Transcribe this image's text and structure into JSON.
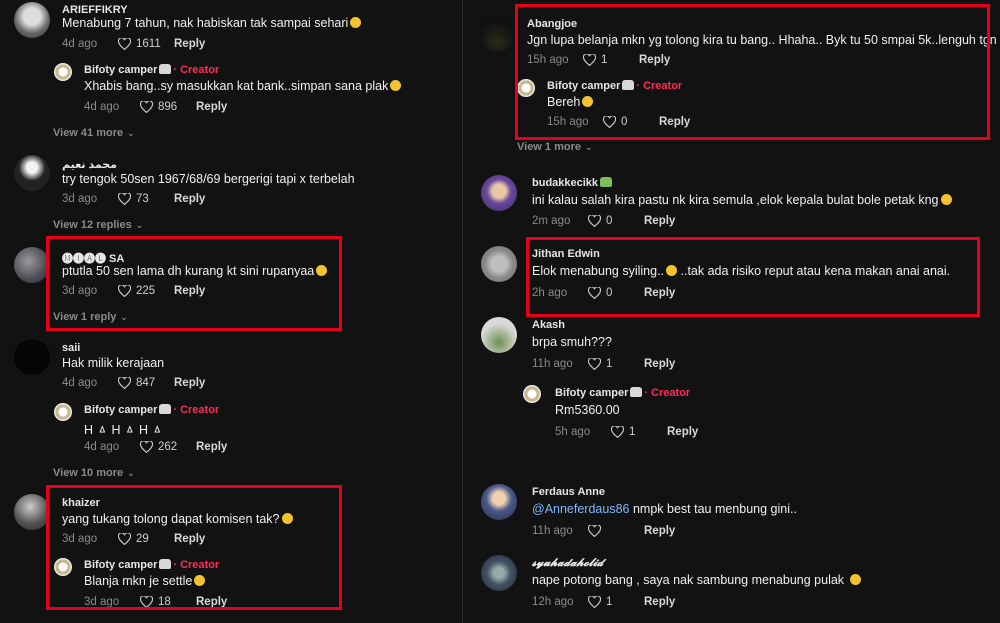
{
  "left": {
    "comments": [
      {
        "user": "ARIEFFIKRY",
        "text": "Menabung 7 tahun, nak habiskan tak sampai sehari",
        "time": "4d ago",
        "likes": "1611",
        "reply": "Reply"
      },
      {
        "user": "Bifoty camper",
        "creator": "· Creator",
        "text": "Xhabis bang..sy masukkan kat bank..simpan sana plak",
        "time": "4d ago",
        "likes": "896",
        "reply": "Reply"
      },
      {
        "view_more": "View 41 more"
      },
      {
        "user": "محمد نعيم",
        "text": "try tengok 50sen 1967/68/69 bergerigi tapi x terbelah",
        "time": "3d ago",
        "likes": "73",
        "reply": "Reply"
      },
      {
        "view_more": "View 12 replies"
      },
      {
        "user": "🅜🅘🅐🅛 SA",
        "text": "ptutla 50 sen lama dh kurang kt sini rupanyaa",
        "time": "3d ago",
        "likes": "225",
        "reply": "Reply"
      },
      {
        "view_more": "View 1 reply"
      },
      {
        "user": "saii",
        "text": "Hak milik kerajaan",
        "time": "4d ago",
        "likes": "847",
        "reply": "Reply"
      },
      {
        "user": "Bifoty camper",
        "creator": "· Creator",
        "text": "H ㅿ H ㅿ H ㅿ",
        "time": "4d ago",
        "likes": "262",
        "reply": "Reply"
      },
      {
        "view_more": "View 10 more"
      },
      {
        "user": "khaizer",
        "text": "yang tukang tolong dapat komisen tak?",
        "time": "3d ago",
        "likes": "29",
        "reply": "Reply"
      },
      {
        "user": "Bifoty camper",
        "creator": "· Creator",
        "text": "Blanja mkn je settle",
        "time": "3d ago",
        "likes": "18",
        "reply": "Reply"
      }
    ]
  },
  "right": {
    "comments": [
      {
        "user": "Abangjoe",
        "text": "Jgn lupa belanja mkn yg tolong kira tu bang.. Hhaha.. Byk tu 50 smpai 5k..lenguh tgn",
        "time": "15h ago",
        "likes": "1",
        "reply": "Reply"
      },
      {
        "user": "Bifoty camper",
        "creator": "· Creator",
        "text": "Bereh",
        "time": "15h ago",
        "likes": "0",
        "reply": "Reply"
      },
      {
        "view_more": "View 1 more"
      },
      {
        "user": "budakkecikk",
        "text": "ini kalau salah kira pastu nk kira semula ,elok kepala bulat bole petak kng",
        "time": "2m ago",
        "likes": "0",
        "reply": "Reply"
      },
      {
        "user": "Jithan Edwin",
        "text": "Elok menabung syiling..",
        "text2": "..tak ada risiko reput atau kena makan anai anai.",
        "time": "2h ago",
        "likes": "0",
        "reply": "Reply"
      },
      {
        "user": "Akash",
        "text": "brpa smuh???",
        "time": "11h ago",
        "likes": "1",
        "reply": "Reply"
      },
      {
        "user": "Bifoty camper",
        "creator": "· Creator",
        "text": "Rm5360.00",
        "time": "5h ago",
        "likes": "1",
        "reply": "Reply"
      },
      {
        "user": "Ferdaus Anne",
        "mention": "@Anneferdaus86",
        "text": " nmpk best tau menbung gini..",
        "time": "11h ago",
        "likes": "",
        "reply": "Reply"
      },
      {
        "user": "𝓼𝔂𝓾𝓱𝓪𝓭𝓪𝓱𝓸𝓵𝓲𝓭",
        "text": "nape potong bang , saya nak sambung menabung pulak",
        "time": "12h ago",
        "likes": "1",
        "reply": "Reply"
      }
    ]
  },
  "colors": {
    "background": "#121212",
    "creator": "#fe2c55",
    "highlight_box": "#e5001b",
    "mention": "#7cb7ff"
  }
}
